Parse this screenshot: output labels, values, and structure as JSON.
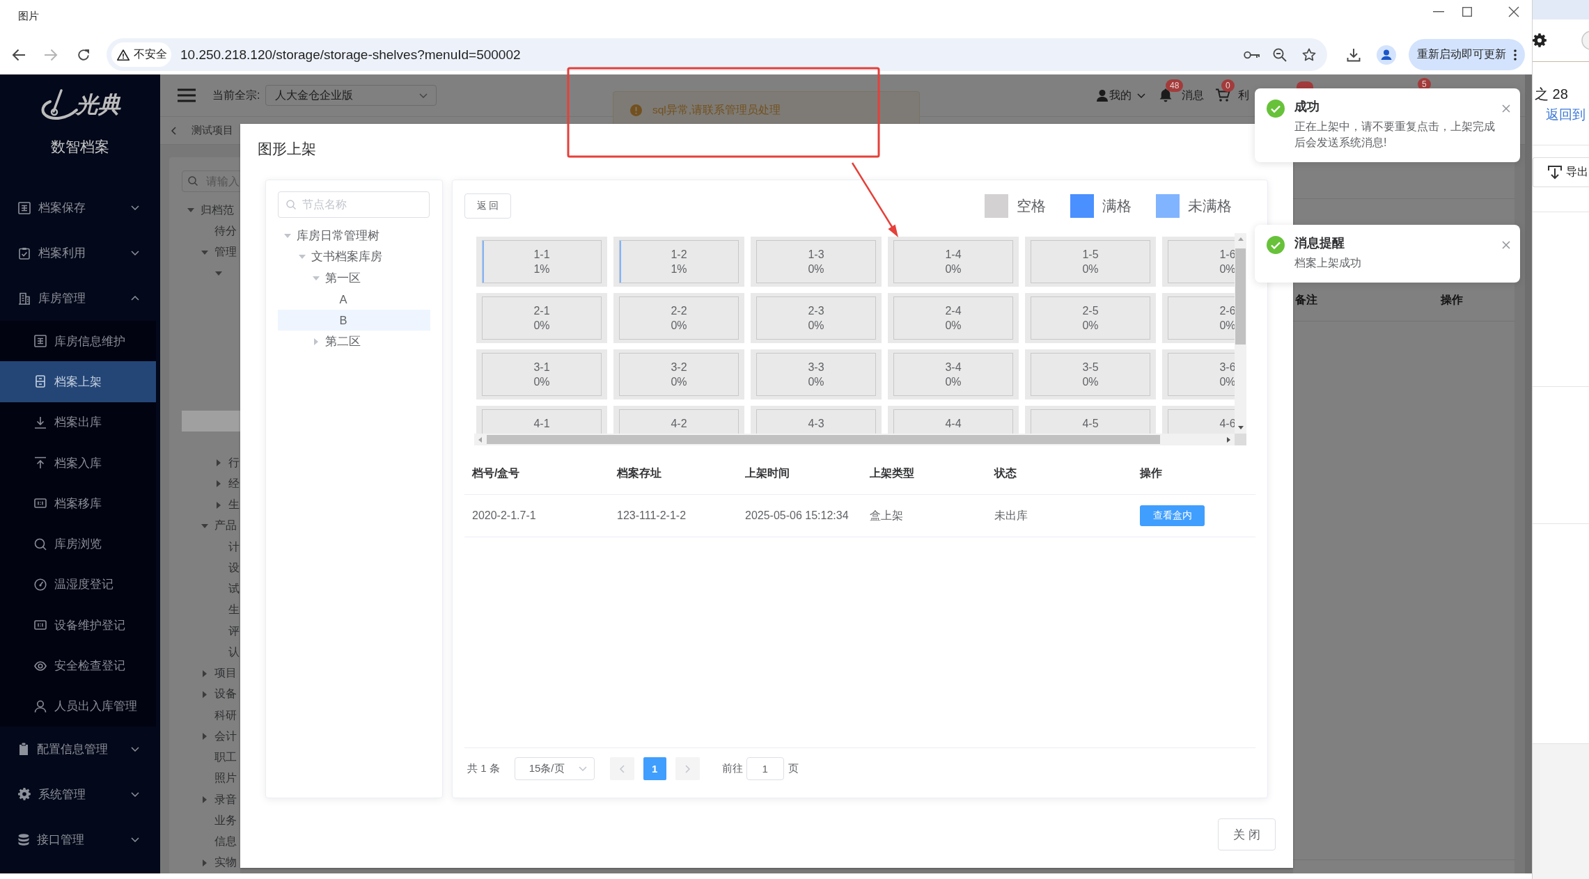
{
  "window": {
    "title": "图片"
  },
  "browser": {
    "security_label": "不安全",
    "url": "10.250.218.120/storage/storage-shelves?menuId=500002",
    "update_button": "重新启动即可更新"
  },
  "sidebar": {
    "logo": "光典",
    "product": "数智档案",
    "items": [
      {
        "label": "档案保存",
        "expanded": false
      },
      {
        "label": "档案利用",
        "expanded": false
      },
      {
        "label": "库房管理",
        "expanded": true,
        "children": [
          {
            "label": "库房信息维护",
            "selected": false
          },
          {
            "label": "档案上架",
            "selected": true
          },
          {
            "label": "档案出库",
            "selected": false
          },
          {
            "label": "档案入库",
            "selected": false
          },
          {
            "label": "档案移库",
            "selected": false
          },
          {
            "label": "库房浏览",
            "selected": false
          },
          {
            "label": "温湿度登记",
            "selected": false
          },
          {
            "label": "设备维护登记",
            "selected": false
          },
          {
            "label": "安全检查登记",
            "selected": false
          },
          {
            "label": "人员出入库管理",
            "selected": false
          }
        ]
      },
      {
        "label": "配置信息管理",
        "expanded": false
      },
      {
        "label": "系统管理",
        "expanded": false
      },
      {
        "label": "接口管理",
        "expanded": false
      }
    ]
  },
  "header": {
    "fonds_label": "当前全宗:",
    "fonds_value": "人大金仓企业版",
    "items": [
      {
        "kind": "user",
        "label": "我的"
      },
      {
        "kind": "bell",
        "label": "消息",
        "badge": "48"
      },
      {
        "kind": "cart",
        "label": "利",
        "badge": "0"
      },
      {
        "kind": "covered"
      },
      {
        "kind": "covered",
        "badge": "5"
      }
    ]
  },
  "breadcrumb": {
    "label": "测试项目"
  },
  "background_tree": {
    "placeholder": "请输入",
    "nodes": [
      {
        "label": "归档范",
        "expanded": true,
        "selected": false,
        "children": [
          {
            "label": "待分",
            "selected": false
          },
          {
            "label": "管理",
            "expanded": true,
            "selected": false,
            "children": [
              {
                "expanded": true,
                "selected": false,
                "children": [
                  {
                    "selected": false
                  },
                  {
                    "selected": false
                  },
                  {
                    "selected": false
                  },
                  {
                    "selected": false
                  },
                  {
                    "selected": false
                  },
                  {
                    "selected": false
                  },
                  {
                    "selected": true
                  },
                  {
                    "selected": false
                  }
                ]
              },
              {
                "label": "行",
                "expanded": false,
                "selected": false
              },
              {
                "label": "经",
                "expanded": false,
                "selected": false
              },
              {
                "label": "生",
                "expanded": false,
                "selected": false
              }
            ]
          },
          {
            "label": "产品",
            "expanded": true,
            "selected": false,
            "children": [
              {
                "label": "计",
                "selected": false
              },
              {
                "label": "设",
                "selected": false
              },
              {
                "label": "试",
                "selected": false
              },
              {
                "label": "生",
                "selected": false
              },
              {
                "label": "评",
                "selected": false
              },
              {
                "label": "认",
                "selected": false
              }
            ]
          },
          {
            "label": "项目",
            "expanded": false,
            "selected": false
          },
          {
            "label": "设备",
            "expanded": false,
            "selected": false
          },
          {
            "label": "科研",
            "selected": false
          },
          {
            "label": "会计",
            "expanded": false,
            "selected": false
          },
          {
            "label": "职工",
            "selected": false
          },
          {
            "label": "照片",
            "selected": false
          },
          {
            "label": "录音",
            "expanded": false,
            "selected": false
          },
          {
            "label": "业务",
            "selected": false
          },
          {
            "label": "信息",
            "selected": false
          },
          {
            "label": "实物",
            "expanded": false,
            "selected": false
          }
        ]
      }
    ]
  },
  "background_table": {
    "columns": [
      "备注",
      "操作"
    ]
  },
  "warning_toast": {
    "message": "sql异常,请联系管理员处理"
  },
  "dialog": {
    "title": "图形上架",
    "tree": {
      "placeholder": "节点名称",
      "nodes": [
        {
          "label": "库房日常管理树",
          "expanded": true,
          "selected": false,
          "children": [
            {
              "label": "文书档案库房",
              "expanded": true,
              "selected": false,
              "children": [
                {
                  "label": "第一区",
                  "expanded": true,
                  "selected": false,
                  "children": [
                    {
                      "label": "A",
                      "selected": false
                    },
                    {
                      "label": "B",
                      "selected": true
                    }
                  ]
                },
                {
                  "label": "第二区",
                  "expanded": false,
                  "selected": false
                }
              ]
            }
          ]
        }
      ]
    },
    "back_button": "返 回",
    "legend": [
      {
        "kind": "empty",
        "label": "空格",
        "color": "#d3d1d2"
      },
      {
        "kind": "full",
        "label": "满格",
        "color": "#4a90ff"
      },
      {
        "kind": "partial",
        "label": "未满格",
        "color": "#80b4ff"
      }
    ],
    "shelf_rows": [
      {
        "cells": [
          {
            "label": "1-1",
            "percent": "1%",
            "level": 0.01
          },
          {
            "label": "1-2",
            "percent": "1%",
            "level": 0.01
          },
          {
            "label": "1-3",
            "percent": "0%",
            "level": 0
          },
          {
            "label": "1-4",
            "percent": "0%",
            "level": 0
          },
          {
            "label": "1-5",
            "percent": "0%",
            "level": 0
          },
          {
            "label": "1-6",
            "percent": "0%",
            "level": 0
          }
        ]
      },
      {
        "cells": [
          {
            "label": "2-1",
            "percent": "0%",
            "level": 0
          },
          {
            "label": "2-2",
            "percent": "0%",
            "level": 0
          },
          {
            "label": "2-3",
            "percent": "0%",
            "level": 0
          },
          {
            "label": "2-4",
            "percent": "0%",
            "level": 0
          },
          {
            "label": "2-5",
            "percent": "0%",
            "level": 0
          },
          {
            "label": "2-6",
            "percent": "0%",
            "level": 0
          }
        ]
      },
      {
        "cells": [
          {
            "label": "3-1",
            "percent": "0%",
            "level": 0
          },
          {
            "label": "3-2",
            "percent": "0%",
            "level": 0
          },
          {
            "label": "3-3",
            "percent": "0%",
            "level": 0
          },
          {
            "label": "3-4",
            "percent": "0%",
            "level": 0
          },
          {
            "label": "3-5",
            "percent": "0%",
            "level": 0
          },
          {
            "label": "3-6",
            "percent": "0%",
            "level": 0
          }
        ]
      },
      {
        "cells": [
          {
            "label": "4-1",
            "level": 0
          },
          {
            "label": "4-2",
            "level": 0
          },
          {
            "label": "4-3",
            "level": 0
          },
          {
            "label": "4-4",
            "level": 0
          },
          {
            "label": "4-5",
            "level": 0
          },
          {
            "label": "4-6",
            "level": 0
          }
        ]
      }
    ],
    "table": {
      "columns": [
        "档号/盒号",
        "档案存址",
        "上架时间",
        "上架类型",
        "状态",
        "操作"
      ],
      "rows": [
        {
          "cells": [
            "2020-2-1.7-1",
            "123-111-2-1-2",
            "2025-05-06 15:12:34",
            "盒上架",
            "未出库"
          ],
          "action": "查看盒内"
        }
      ]
    },
    "pagination": {
      "total": "共 1 条",
      "page_size": "15条/页",
      "pages": [
        {
          "label": "1",
          "selected": true
        }
      ],
      "goto_label": "前往",
      "goto_value": "1",
      "goto_suffix": "页"
    },
    "close_button": "关 闭"
  },
  "notifications": [
    {
      "kind": "success",
      "title": "成功",
      "message": "正在上架中，请不要重复点击，上架完成后会发送系统消息!"
    },
    {
      "kind": "success",
      "title": "消息提醒",
      "message": "档案上架成功"
    }
  ],
  "side_window": {
    "count": "之 28",
    "link": "返回到",
    "export_button": "导出"
  }
}
